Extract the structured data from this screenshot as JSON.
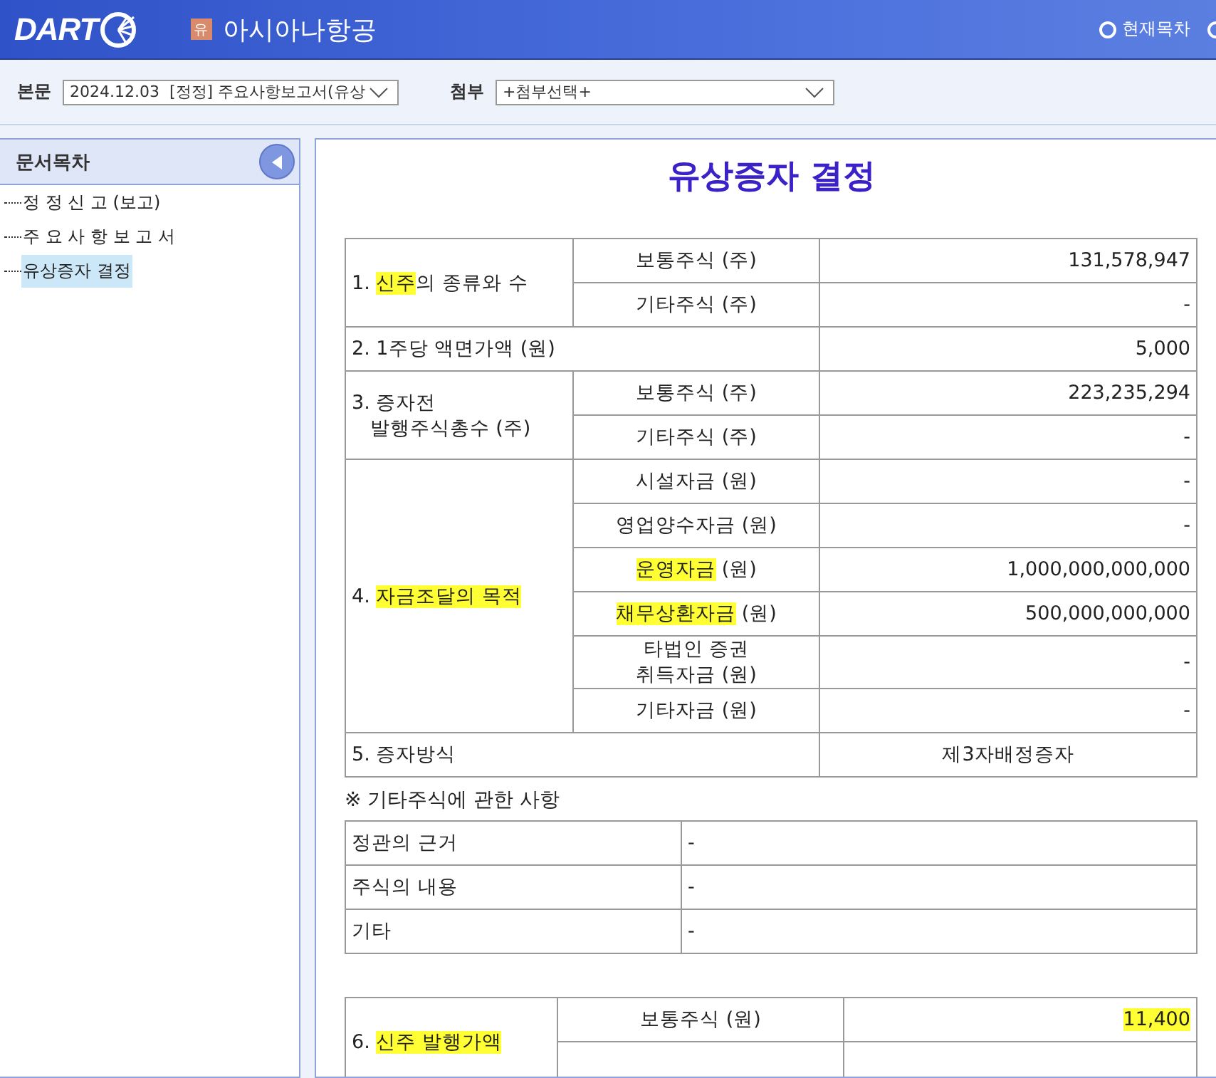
{
  "header": {
    "logo": "DART",
    "company_badge": "유",
    "company": "아시아나항공",
    "view_option": {
      "label": "현재목차",
      "selected": false
    }
  },
  "toolbar": {
    "body_label": "본문",
    "body_select": "2024.12.03  [정정] 주요사항보고서(유상",
    "attach_label": "첨부",
    "attach_select": "+첨부선택+"
  },
  "sidebar": {
    "title": "문서목차",
    "items": [
      {
        "label": "정 정 신 고 (보고)",
        "selected": false
      },
      {
        "label": "주 요 사 항 보 고 서",
        "selected": false
      },
      {
        "label": "유상증자 결정",
        "selected": true
      }
    ]
  },
  "document": {
    "title": "유상증자 결정",
    "table_1": [
      [
        {
          "kind": "label",
          "rowspan": 2,
          "text": [
            {
              "t": "1. ",
              "hl": false
            },
            {
              "t": "신주",
              "hl": true
            },
            {
              "t": "의 종류와 수",
              "hl": false
            }
          ]
        },
        {
          "kind": "sub",
          "text": [
            {
              "t": "보통주식 (주)",
              "hl": false
            }
          ]
        },
        {
          "kind": "value",
          "text": [
            {
              "t": "131,578,947",
              "hl": false
            }
          ]
        }
      ],
      [
        {
          "kind": "sub",
          "text": [
            {
              "t": "기타주식 (주)",
              "hl": false
            }
          ]
        },
        {
          "kind": "value",
          "text": [
            {
              "t": "-",
              "hl": false
            }
          ]
        }
      ],
      [
        {
          "kind": "label",
          "colspan": 2,
          "text": [
            {
              "t": "2. 1주당 액면가액 (원)",
              "hl": false
            }
          ]
        },
        {
          "kind": "value",
          "text": [
            {
              "t": "5,000",
              "hl": false
            }
          ]
        }
      ],
      [
        {
          "kind": "label",
          "rowspan": 2,
          "text": [
            {
              "t": "3. 증자전\n   발행주식총수 (주)",
              "hl": false
            }
          ]
        },
        {
          "kind": "sub",
          "text": [
            {
              "t": "보통주식 (주)",
              "hl": false
            }
          ]
        },
        {
          "kind": "value",
          "text": [
            {
              "t": "223,235,294",
              "hl": false
            }
          ]
        }
      ],
      [
        {
          "kind": "sub",
          "text": [
            {
              "t": "기타주식 (주)",
              "hl": false
            }
          ]
        },
        {
          "kind": "value",
          "text": [
            {
              "t": "-",
              "hl": false
            }
          ]
        }
      ],
      [
        {
          "kind": "label",
          "rowspan": 6,
          "text": [
            {
              "t": "4. ",
              "hl": false
            },
            {
              "t": "자금조달의 목적",
              "hl": true
            }
          ]
        },
        {
          "kind": "sub",
          "text": [
            {
              "t": "시설자금 (원)",
              "hl": false
            }
          ]
        },
        {
          "kind": "value",
          "text": [
            {
              "t": "-",
              "hl": false
            }
          ]
        }
      ],
      [
        {
          "kind": "sub",
          "text": [
            {
              "t": "영업양수자금 (원)",
              "hl": false
            }
          ]
        },
        {
          "kind": "value",
          "text": [
            {
              "t": "-",
              "hl": false
            }
          ]
        }
      ],
      [
        {
          "kind": "sub",
          "text": [
            {
              "t": "운영자금",
              "hl": true
            },
            {
              "t": " (원)",
              "hl": false
            }
          ]
        },
        {
          "kind": "value",
          "text": [
            {
              "t": "1,000,000,000,000",
              "hl": false
            }
          ]
        }
      ],
      [
        {
          "kind": "sub",
          "text": [
            {
              "t": "채무상환자금",
              "hl": true
            },
            {
              "t": " (원)",
              "hl": false
            }
          ]
        },
        {
          "kind": "value",
          "text": [
            {
              "t": "500,000,000,000",
              "hl": false
            }
          ]
        }
      ],
      [
        {
          "kind": "sub",
          "text": [
            {
              "t": "타법인 증권\n취득자금 (원)",
              "hl": false
            }
          ]
        },
        {
          "kind": "value",
          "text": [
            {
              "t": "-",
              "hl": false
            }
          ]
        }
      ],
      [
        {
          "kind": "sub",
          "text": [
            {
              "t": "기타자금 (원)",
              "hl": false
            }
          ]
        },
        {
          "kind": "value",
          "text": [
            {
              "t": "-",
              "hl": false
            }
          ]
        }
      ],
      [
        {
          "kind": "label",
          "colspan": 2,
          "text": [
            {
              "t": "5. 증자방식",
              "hl": false
            }
          ]
        },
        {
          "kind": "center",
          "text": [
            {
              "t": "제3자배정증자",
              "hl": false
            }
          ]
        }
      ]
    ],
    "note": "※ 기타주식에 관한 사항",
    "table_2": [
      [
        {
          "text": [
            {
              "t": "정관의 근거",
              "hl": false
            }
          ]
        },
        {
          "text": [
            {
              "t": "-",
              "hl": false
            }
          ]
        }
      ],
      [
        {
          "text": [
            {
              "t": "주식의 내용",
              "hl": false
            }
          ]
        },
        {
          "text": [
            {
              "t": "-",
              "hl": false
            }
          ]
        }
      ],
      [
        {
          "text": [
            {
              "t": "기타",
              "hl": false
            }
          ]
        },
        {
          "text": [
            {
              "t": "-",
              "hl": false
            }
          ]
        }
      ]
    ],
    "table_3": [
      [
        {
          "kind": "label",
          "rowspan": 2,
          "text": [
            {
              "t": "6. ",
              "hl": false
            },
            {
              "t": "신주 발행가액",
              "hl": true
            }
          ]
        },
        {
          "kind": "sub",
          "text": [
            {
              "t": "보통주식 (원)",
              "hl": false
            }
          ]
        },
        {
          "kind": "value",
          "text": [
            {
              "t": "11,400",
              "hl": true
            }
          ]
        }
      ],
      [
        {
          "kind": "sub"
        },
        {
          "kind": "value"
        }
      ]
    ]
  }
}
